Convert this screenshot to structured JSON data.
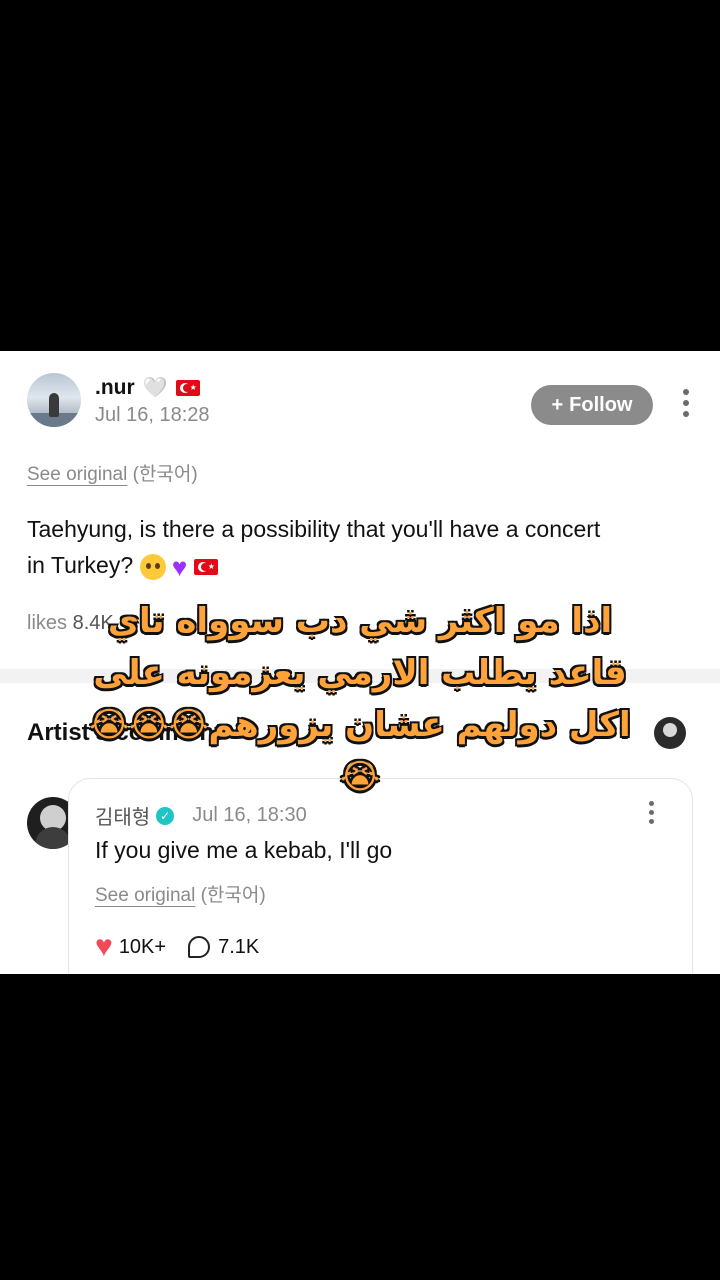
{
  "post": {
    "username": ".nur",
    "heart_emoji": "🤍",
    "date": "Jul 16, 18:28",
    "follow_label": "Follow",
    "see_original": "See original",
    "language": "(한국어)",
    "body_line1": "Taehyung, is there a possibility that you'll have a concert",
    "body_line2": "in Turkey?",
    "likes_label": "likes",
    "likes_count": "8.4K"
  },
  "artist_section": {
    "title": "Artist's comment"
  },
  "comment": {
    "author": "김태형",
    "date": "Jul 16, 18:30",
    "text": "If you give me a kebab, I'll go",
    "see_original": "See original",
    "language": "(한국어)",
    "likes": "10K+",
    "replies": "7.1K"
  },
  "overlay": {
    "line1": "اذا مو اكثر شي دب سوواه تاي",
    "line2": "قاعد يطلب الارمي يعزمونه على",
    "line3": "اكل دولهم عشان يزورهم😭😭😭",
    "line4": "😭"
  },
  "colors": {
    "follow_bg": "#8b8b8b",
    "verified": "#1fc4c4",
    "like_heart": "#f04a58",
    "overlay_text": "#ffa23a"
  }
}
